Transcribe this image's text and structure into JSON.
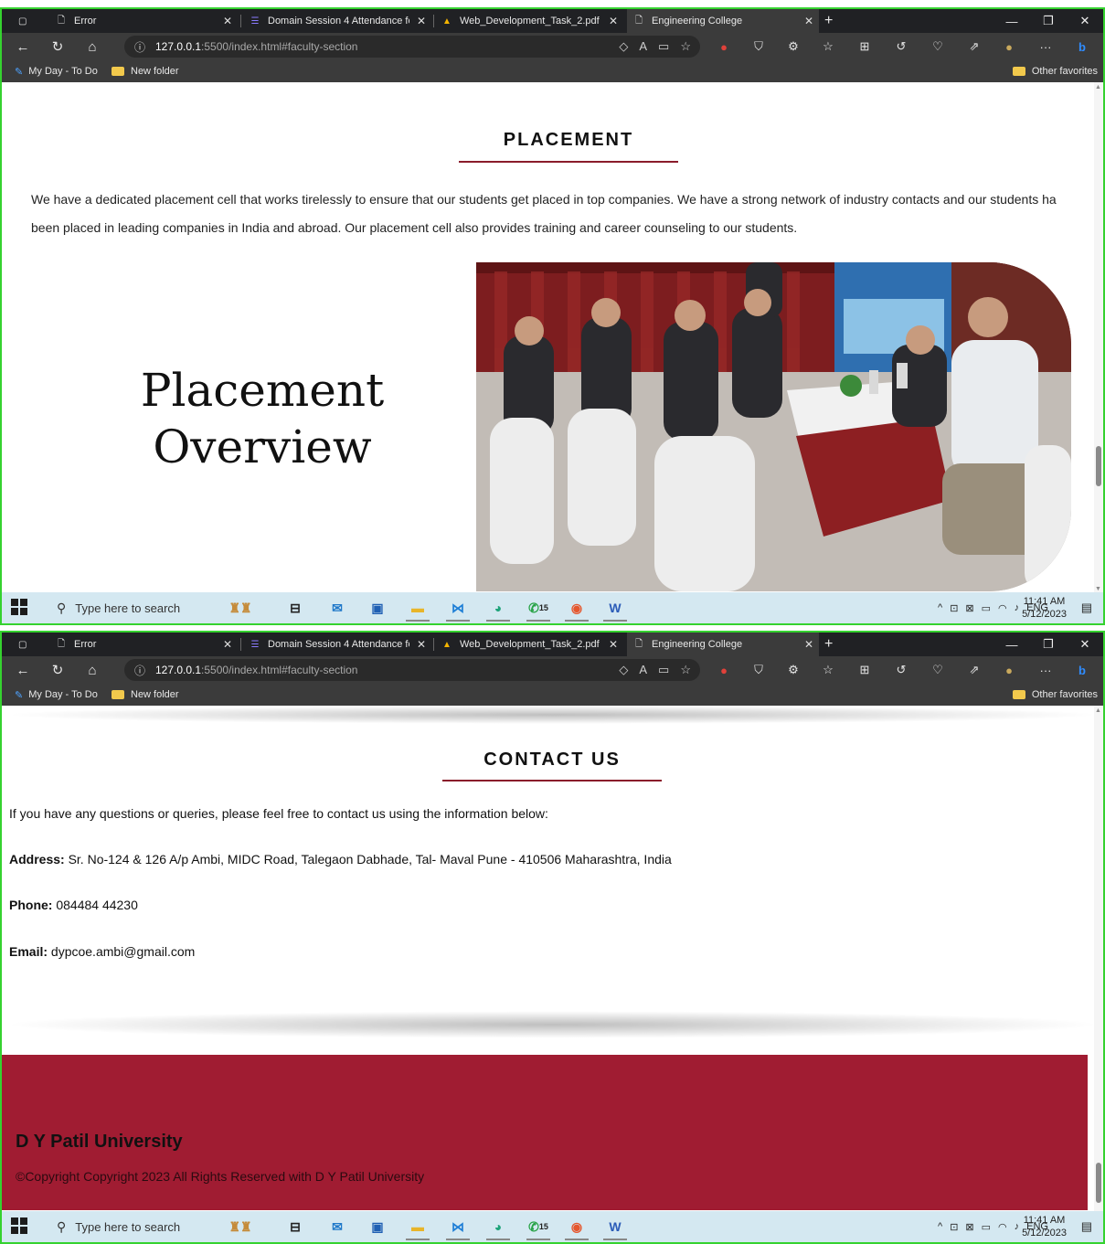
{
  "browser": {
    "tabs": [
      {
        "title": "Error",
        "icon": "page-icon"
      },
      {
        "title": "Domain Session 4 Attendance fo",
        "icon": "forms-icon"
      },
      {
        "title": "Web_Development_Task_2.pdf - ",
        "icon": "drive-icon"
      },
      {
        "title": "Engineering College",
        "icon": "page-icon",
        "active": true
      }
    ],
    "url_host": "127.0.0.1",
    "url_path": ":5500/index.html#faculty-section",
    "favorites": [
      "My Day - To Do",
      "New folder"
    ],
    "other_favorites": "Other favorites"
  },
  "taskbar": {
    "search_placeholder": "Type here to search",
    "whatsapp_badge": "15",
    "language": "ENG",
    "time": "11:41 AM",
    "date": "5/12/2023"
  },
  "placement": {
    "heading": "PLACEMENT",
    "para_line1": "We have a dedicated placement cell that works tirelessly to ensure that our students get placed in top companies. We have a strong network of industry contacts and our students ha",
    "para_line2": "been placed in leading companies in India and abroad. Our placement cell also provides training and career counseling to our students.",
    "overview_line1": "Placement",
    "overview_line2": "Overview"
  },
  "contact": {
    "heading": "CONTACT US",
    "intro": "If you have any questions or queries, please feel free to contact us using the information below:",
    "address_label": "Address:",
    "address": "Sr. No-124 & 126 A/p Ambi, MIDC Road, Talegaon Dabhade, Tal- Maval Pune - 410506 Maharashtra, India",
    "phone_label": "Phone:",
    "phone": "084484 44230",
    "email_label": "Email:",
    "email": "dypcoe.ambi@gmail.com"
  },
  "footer": {
    "title": "D Y Patil University",
    "copyright": "©Copyright Copyright 2023 All Rights Reserved with D Y Patil University"
  },
  "colors": {
    "accent": "#8a1c2b",
    "footer_bg": "#a01c32",
    "frame": "#35d22f"
  }
}
